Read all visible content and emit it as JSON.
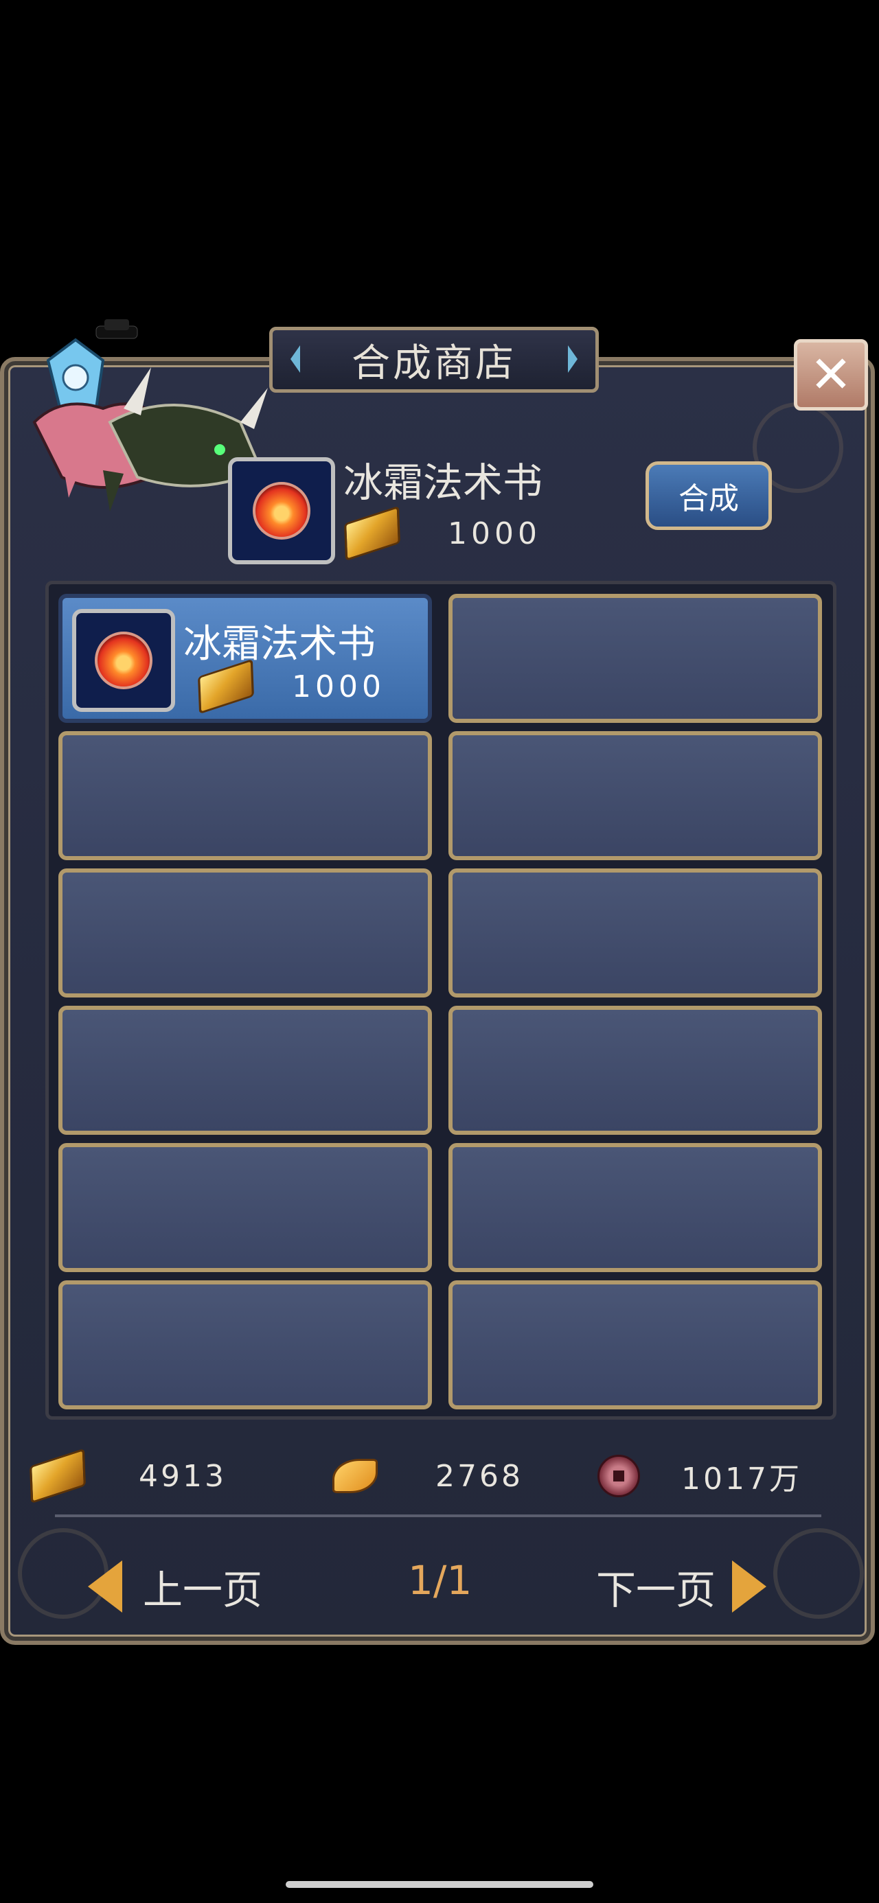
{
  "window": {
    "title": "合成商店",
    "close_label": "✕"
  },
  "header": {
    "item_name": "冰霜法术书",
    "price": "1000",
    "combine_label": "合成"
  },
  "slots": [
    {
      "name": "冰霜法术书",
      "price": "1000",
      "selected": true
    },
    {
      "name": "",
      "price": ""
    },
    {
      "name": "",
      "price": ""
    },
    {
      "name": "",
      "price": ""
    },
    {
      "name": "",
      "price": ""
    },
    {
      "name": "",
      "price": ""
    },
    {
      "name": "",
      "price": ""
    },
    {
      "name": "",
      "price": ""
    },
    {
      "name": "",
      "price": ""
    },
    {
      "name": "",
      "price": ""
    },
    {
      "name": "",
      "price": ""
    },
    {
      "name": "",
      "price": ""
    }
  ],
  "currencies": {
    "gold": "4913",
    "leaf": "2768",
    "coin": "1017万"
  },
  "pagination": {
    "prev_label": "上一页",
    "page": "1/1",
    "next_label": "下一页"
  },
  "colors": {
    "panel": "#262b3f",
    "slot": "#3f4a6a",
    "slot_border": "#b29a6b",
    "selected": "#4a7ab8",
    "accent": "#e4a43c"
  },
  "icons": [
    "gold-ingot-icon",
    "leaf-icon",
    "coin-icon",
    "fire-book-icon",
    "close-icon",
    "left-arrow-icon",
    "right-arrow-icon"
  ]
}
